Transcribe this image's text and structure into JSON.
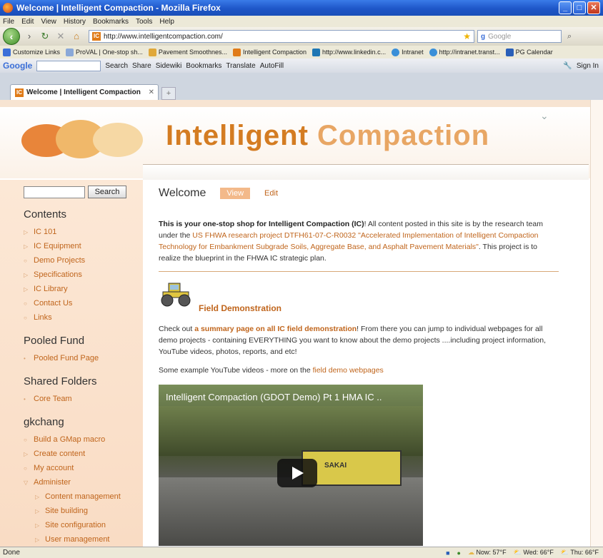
{
  "window": {
    "title": "Welcome | Intelligent Compaction - Mozilla Firefox",
    "menu": [
      "File",
      "Edit",
      "View",
      "History",
      "Bookmarks",
      "Tools",
      "Help"
    ]
  },
  "nav": {
    "url": "http://www.intelligentcompaction.com/",
    "search_placeholder": "Google"
  },
  "bookmarks": [
    "Customize Links",
    "ProVAL | One-stop sh...",
    "Pavement Smoothnes...",
    "Intelligent Compaction",
    "http://www.linkedin.c...",
    "Intranet",
    "http://intranet.transt...",
    "PG Calendar"
  ],
  "googlebar": {
    "logo": "Google",
    "items": [
      "Search",
      "Share",
      "Sidewiki",
      "Bookmarks",
      "Translate",
      "AutoFill",
      "Sign In"
    ]
  },
  "tab": {
    "label": "Welcome | Intelligent Compaction"
  },
  "site": {
    "title_word1": "Intelligent",
    "title_word2": "Compaction"
  },
  "sidebar": {
    "search_button": "Search",
    "contents_heading": "Contents",
    "contents": [
      "IC 101",
      "IC Equipment",
      "Demo Projects",
      "Specifications",
      "IC Library",
      "Contact Us",
      "Links"
    ],
    "pooled_heading": "Pooled Fund",
    "pooled": [
      "Pooled Fund Page"
    ],
    "shared_heading": "Shared Folders",
    "shared": [
      "Core Team"
    ],
    "user_heading": "gkchang",
    "user_links": [
      "Build a GMap macro",
      "Create content",
      "My account",
      "Administer"
    ],
    "admin_links": [
      "Content management",
      "Site building",
      "Site configuration",
      "User management"
    ]
  },
  "main": {
    "heading": "Welcome",
    "view_tab": "View",
    "edit_tab": "Edit",
    "intro_bold": "This is your one-stop shop for Intelligent Compaction (IC)",
    "intro_text1": "! All content posted in this site is by the research team under the ",
    "intro_link": "US FHWA research project DTFH61-07-C-R0032 \"Accelerated Implementation of Intelligent Compaction Technology for Embankment Subgrade Soils, Aggregate Base, and Asphalt Pavement Materials\"",
    "intro_text2": ". This project is to realize the blueprint in the FHWA IC strategic plan.",
    "fd_title": "Field Demonstration",
    "fd_text1": "Check out ",
    "fd_link": "a summary page on all IC field demonstration",
    "fd_text2": "! From there you can jump to individual webpages for all demo projects - containing EVERYTHING you want to know about the demo projects ....including project information, YouTube videos, photos, reports, and etc!",
    "yt_text": "Some example YouTube videos - more on the ",
    "yt_link": "field demo webpages",
    "video_title": "Intelligent Compaction (GDOT Demo) Pt 1 HMA IC ..",
    "video_brand": "SAKAI"
  },
  "status": {
    "left": "Done",
    "weather": [
      "Now: 57°F",
      "Wed: 66°F",
      "Thu: 66°F"
    ]
  }
}
